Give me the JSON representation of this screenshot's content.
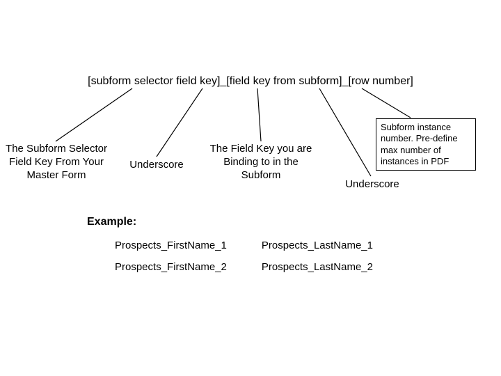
{
  "syntax": "[subform selector field key]_[field key from subform]_[row number]",
  "labels": {
    "selector": "The Subform Selector Field Key From Your Master Form",
    "underscore1": "Underscore",
    "fieldkey": "The Field Key you are Binding to in the Subform",
    "underscore2": "Underscore",
    "callout": "Subform instance number. Pre-define max number of instances in PDF"
  },
  "example": {
    "heading": "Example:",
    "cells": [
      "Prospects_FirstName_1",
      "Prospects_LastName_1",
      "Prospects_FirstName_2",
      "Prospects_LastName_2"
    ]
  }
}
